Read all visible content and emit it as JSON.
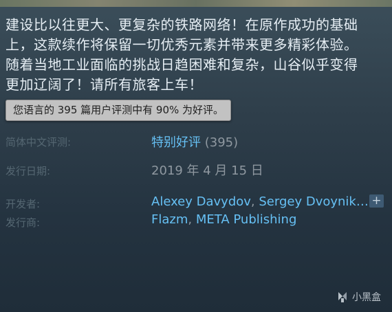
{
  "description": "建设比以往更大、更复杂的铁路网络！在原作成功的基础上，这款续作将保留一切优秀元素并带来更多精彩体验。随着当地工业面临的挑战日趋困难和复杂，山谷似乎变得更加辽阔了！请所有旅客上车！",
  "description_lines": [
    "建设比以往更大、更复杂的铁路网络！在原作成功的基础",
    "上，这款续作将保留一切优秀元素并带来更多精彩体验。",
    "随着当地工业面临的挑战日趋困难和复杂，山谷似乎变得",
    "更加辽阔了！请所有旅客上车！"
  ],
  "tooltip": "您语言的 395 篇用户评测中有 90% 为好评。",
  "reviews": {
    "label": "简体中文评测:",
    "rating": "特别好评",
    "count": "(395)"
  },
  "release": {
    "label": "发行日期:",
    "date": "2019 年 4 月 15 日"
  },
  "developer": {
    "label": "开发者:",
    "names": [
      "Alexey Davydov",
      "Sergey Dvoynik…"
    ],
    "separator": ",",
    "more_label": "+"
  },
  "publisher": {
    "label": "发行商:",
    "names": [
      "Flazm",
      "META Publishing"
    ],
    "separator": ","
  },
  "watermark": {
    "text": "小黑盒",
    "icon": "xiaoheihe-logo-icon"
  },
  "colors": {
    "link": "#66c0f4",
    "label": "#556772",
    "value": "#8f98a0",
    "description": "#e6eef4",
    "tooltip_bg": "#c2c2c2"
  }
}
